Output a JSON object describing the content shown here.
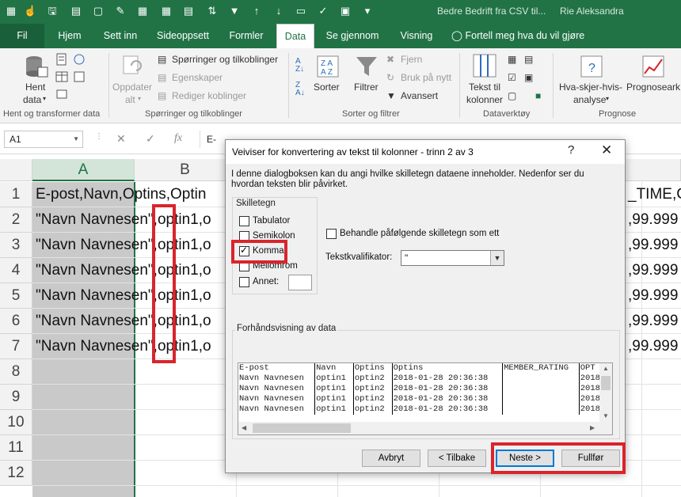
{
  "window": {
    "doc_title": "Bedre Bedrift fra CSV til...",
    "user_name": "Rie Aleksandra"
  },
  "tabs": [
    "Fil",
    "Hjem",
    "Sett inn",
    "Sideoppsett",
    "Formler",
    "Data",
    "Se gjennom",
    "Visning"
  ],
  "active_tab": "Data",
  "tell_me": "Fortell meg hva du vil gjøre",
  "ribbon": {
    "get_data_label_1": "Hent",
    "get_data_label_2": "data",
    "group_get_transform": "Hent og transformer data",
    "refresh_label_1": "Oppdater",
    "refresh_label_2": "alt",
    "queries_connections": "Spørringer og tilkoblinger",
    "properties": "Egenskaper",
    "edit_links": "Rediger koblinger",
    "group_queries": "Spørringer og tilkoblinger",
    "sort_label": "Sorter",
    "filter_label": "Filtrer",
    "clear": "Fjern",
    "reapply": "Bruk på nytt",
    "advanced": "Avansert",
    "group_sort_filter": "Sorter og filtrer",
    "text_to_columns_1": "Tekst til",
    "text_to_columns_2": "kolonner",
    "group_data_tools": "Dataverktøy",
    "whatif_1": "Hva-skjer-hvis-",
    "whatif_2": "analyse",
    "forecast": "Prognoseark",
    "group_forecast": "Prognose"
  },
  "formula_bar": {
    "name_box": "A1",
    "fx": "fx",
    "content": "E-"
  },
  "grid": {
    "columns": [
      "A",
      "B"
    ],
    "row_numbers": [
      "1",
      "2",
      "3",
      "4",
      "5",
      "6",
      "7",
      "8",
      "9",
      "10",
      "11",
      "12"
    ],
    "row1_text": "E-post,Navn,Optins,Optin",
    "row1_right": "_TIME,C",
    "data_row_text": "\"Navn Navnesen\",optin1,o",
    "data_row_right": ",99.999"
  },
  "dialog": {
    "title": "Veiviser for konvertering av tekst til kolonner - trinn 2 av 3",
    "help": "?",
    "close": "✕",
    "description": "I denne dialogboksen kan du angi hvilke skilletegn dataene inneholder. Nedenfor ser du hvordan teksten blir påvirket.",
    "delimiters_title": "Skilletegn",
    "tab_label": "Tabulator",
    "semicolon_label": "Semikolon",
    "comma_label": "Komma",
    "space_label": "Mellomrom",
    "other_label": "Annet:",
    "consecutive_label": "Behandle påfølgende skilletegn som ett",
    "text_qualifier_label": "Tekstkvalifikator:",
    "text_qualifier_value": "\"",
    "preview_title": "Forhåndsvisning av data",
    "preview_rows": [
      [
        "E-post",
        "Navn",
        "Optins",
        "Optins",
        "MEMBER_RATING",
        "OPT"
      ],
      [
        "Navn Navnesen",
        "optin1",
        "optin2",
        "2018-01-28 20:36:38",
        "",
        "2018"
      ],
      [
        "Navn Navnesen",
        "optin1",
        "optin2",
        "2018-01-28 20:36:38",
        "",
        "2018"
      ],
      [
        "Navn Navnesen",
        "optin1",
        "optin2",
        "2018-01-28 20:36:38",
        "",
        "2018"
      ],
      [
        "Navn Navnesen",
        "optin1",
        "optin2",
        "2018-01-28 20:36:38",
        "",
        "2018"
      ]
    ],
    "buttons": {
      "cancel": "Avbryt",
      "back": "< Tilbake",
      "next": "Neste >",
      "finish": "Fullfør"
    }
  }
}
